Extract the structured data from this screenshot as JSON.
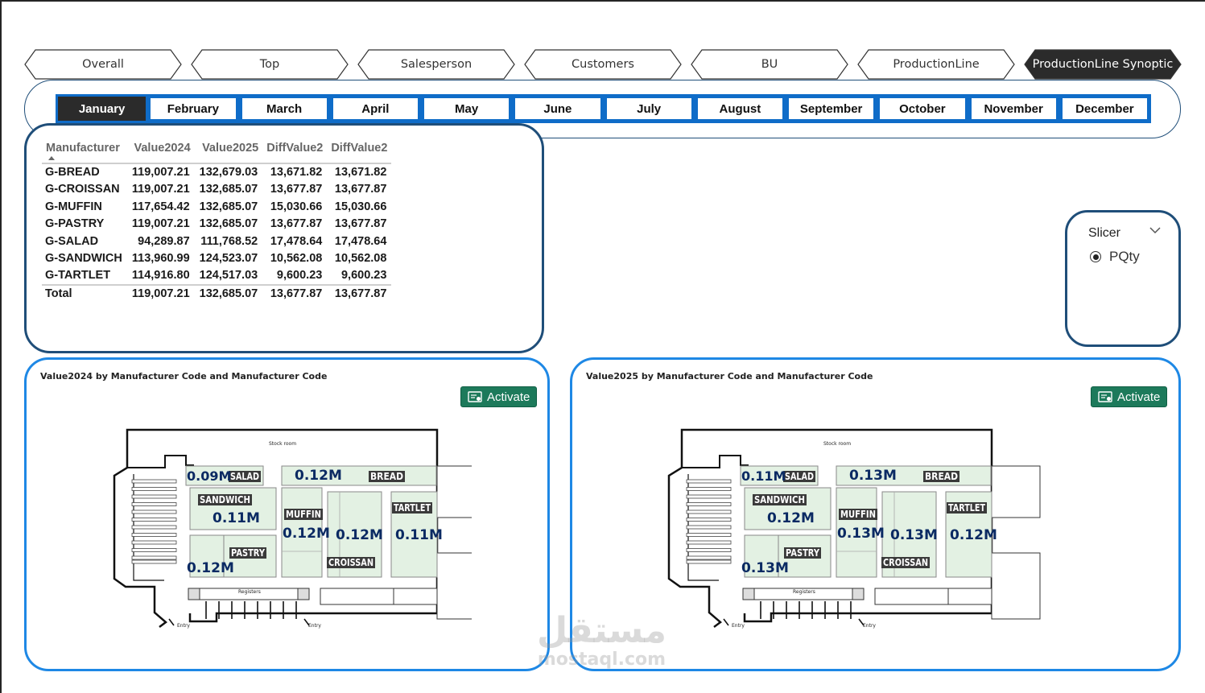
{
  "nav": {
    "tabs": [
      "Overall",
      "Top",
      "Salesperson",
      "Customers",
      "BU",
      "ProductionLine",
      "ProductionLine Synoptic"
    ],
    "active_index": 6
  },
  "months": {
    "items": [
      "January",
      "February",
      "March",
      "April",
      "May",
      "June",
      "July",
      "August",
      "September",
      "October",
      "November",
      "December"
    ],
    "active_index": 0
  },
  "table": {
    "headers": [
      "Manufacturer",
      "Value2024",
      "Value2025",
      "DiffValue2",
      "DiffValue2"
    ],
    "rows": [
      [
        "G-BREAD",
        "119,007.21",
        "132,679.03",
        "13,671.82",
        "13,671.82"
      ],
      [
        "G-CROISSAN",
        "119,007.21",
        "132,685.07",
        "13,677.87",
        "13,677.87"
      ],
      [
        "G-MUFFIN",
        "117,654.42",
        "132,685.07",
        "15,030.66",
        "15,030.66"
      ],
      [
        "G-PASTRY",
        "119,007.21",
        "132,685.07",
        "13,677.87",
        "13,677.87"
      ],
      [
        "G-SALAD",
        "94,289.87",
        "111,768.52",
        "17,478.64",
        "17,478.64"
      ],
      [
        "G-SANDWICH",
        "113,960.99",
        "124,523.07",
        "10,562.08",
        "10,562.08"
      ],
      [
        "G-TARTLET",
        "114,916.80",
        "124,517.03",
        "9,600.23",
        "9,600.23"
      ]
    ],
    "total": [
      "Total",
      "119,007.21",
      "132,685.07",
      "13,677.87",
      "13,677.87"
    ]
  },
  "slicer": {
    "title": "Slicer",
    "option": "PQty",
    "selected": true
  },
  "maps": [
    {
      "title": "Value2024 by Manufacturer Code and Manufacturer Code",
      "activate_label": "Activate",
      "stock_room": "Stock room",
      "registers": "Registers",
      "entry": "Entry",
      "values": {
        "SALAD": "0.09M",
        "BREAD": "0.12M",
        "SANDWICH": "0.11M",
        "MUFFIN": "0.12M",
        "CROISSAN": "0.12M",
        "TARTLET": "0.11M",
        "PASTRY": "0.12M"
      }
    },
    {
      "title": "Value2025 by Manufacturer Code and Manufacturer Code",
      "activate_label": "Activate",
      "stock_room": "Stock room",
      "registers": "Registers",
      "entry": "Entry",
      "values": {
        "SALAD": "0.11M",
        "BREAD": "0.13M",
        "SANDWICH": "0.12M",
        "MUFFIN": "0.13M",
        "CROISSAN": "0.13M",
        "TARTLET": "0.12M",
        "PASTRY": "0.13M"
      }
    }
  ],
  "section_labels": [
    "SALAD",
    "BREAD",
    "SANDWICH",
    "MUFFIN",
    "TARTLET",
    "PASTRY",
    "CROISSAN"
  ],
  "watermark": {
    "arabic": "مستقل",
    "latin": "mostaql.com"
  },
  "colors": {
    "active_tab": "#2b2b2b",
    "month_border": "#0f6cc8",
    "card_border": "#1f4e79",
    "map_border": "#1e88e5",
    "activate_bg": "#1d7a5b",
    "section_fill": "#e3f1e3",
    "value_text": "#0b2a63"
  }
}
